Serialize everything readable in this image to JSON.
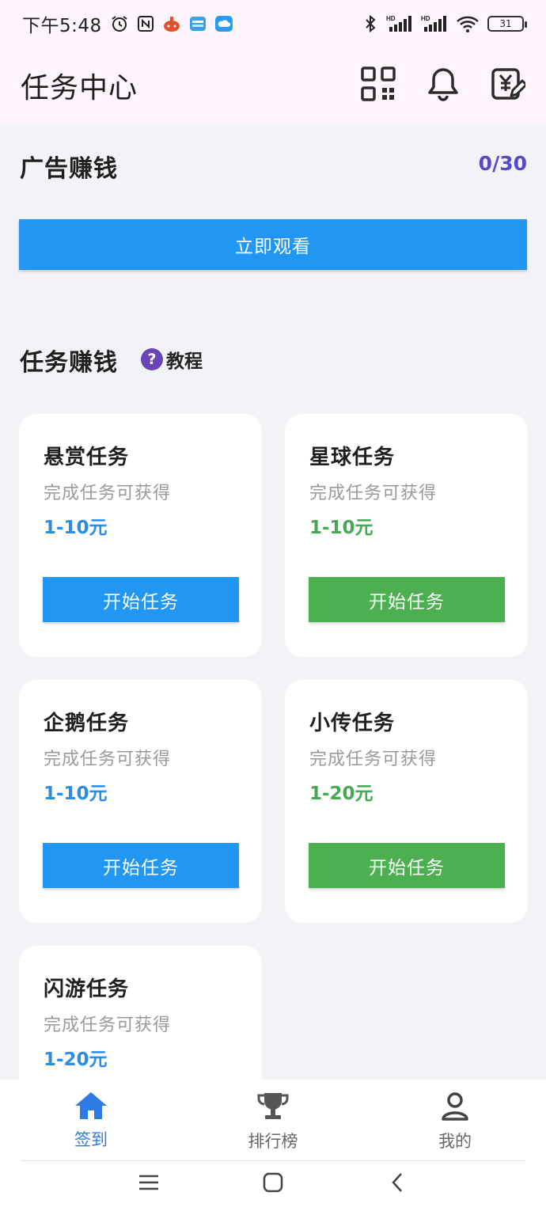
{
  "status_bar": {
    "time": "下午5:48",
    "battery": "31",
    "signal_label_1": "HD",
    "signal_label_2": "HD"
  },
  "header": {
    "title": "任务中心"
  },
  "ad_section": {
    "title": "广告赚钱",
    "counter": "0/30",
    "watch_button": "立即观看"
  },
  "task_section": {
    "title": "任务赚钱",
    "tutorial_label": "教程",
    "tasks": [
      {
        "name": "悬赏任务",
        "desc": "完成任务可获得",
        "reward": "1-10元",
        "button": "开始任务",
        "color": "#2196f3"
      },
      {
        "name": "星球任务",
        "desc": "完成任务可获得",
        "reward": "1-10元",
        "button": "开始任务",
        "color": "#4caf50"
      },
      {
        "name": "企鹅任务",
        "desc": "完成任务可获得",
        "reward": "1-10元",
        "button": "开始任务",
        "color": "#2196f3"
      },
      {
        "name": "小传任务",
        "desc": "完成任务可获得",
        "reward": "1-20元",
        "button": "开始任务",
        "color": "#4caf50"
      },
      {
        "name": "闪游任务",
        "desc": "完成任务可获得",
        "reward": "1-20元"
      }
    ]
  },
  "bottom_nav": {
    "items": [
      {
        "label": "签到",
        "icon": "home-icon",
        "active": true
      },
      {
        "label": "排行榜",
        "icon": "trophy-icon",
        "active": false
      },
      {
        "label": "我的",
        "icon": "user-icon",
        "active": false
      }
    ]
  },
  "colors": {
    "accent_blue": "#2196f3",
    "accent_green": "#4caf50",
    "counter_purple": "#5a49c6"
  }
}
